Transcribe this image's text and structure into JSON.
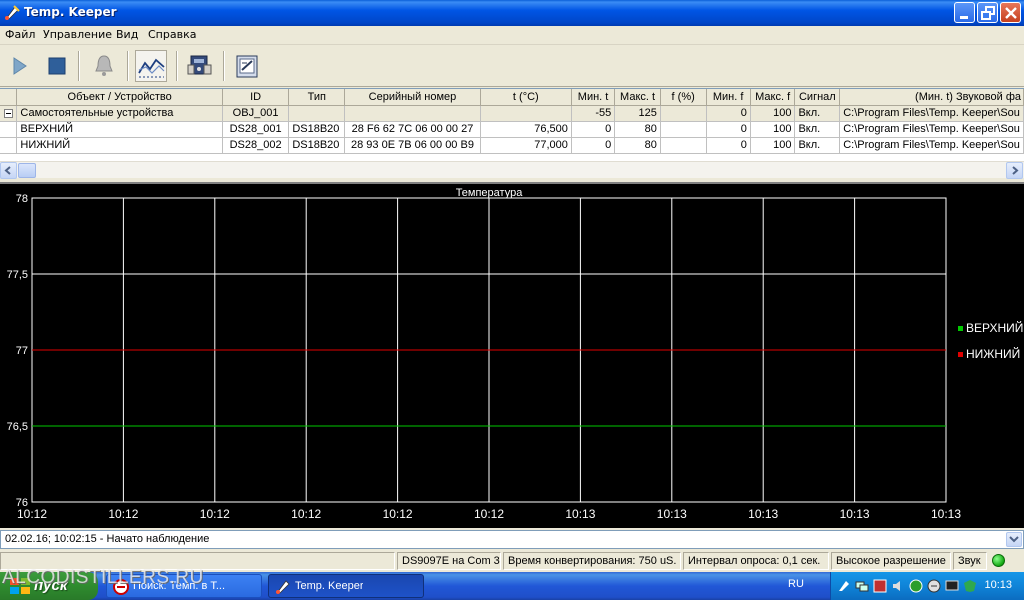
{
  "window": {
    "title": "Temp. Keeper"
  },
  "menu": [
    "Файл",
    "Управление",
    "Вид",
    "Справка"
  ],
  "toolbar": {
    "buttons": [
      {
        "name": "play-button",
        "icon": "play-icon"
      },
      {
        "name": "stop-button",
        "icon": "stop-icon"
      },
      {
        "name": "alarm-button",
        "icon": "bell-icon"
      },
      {
        "name": "chart-button",
        "icon": "chart-icon",
        "pressed": true
      },
      {
        "name": "device-button",
        "icon": "device-icon"
      },
      {
        "name": "report-button",
        "icon": "report-icon"
      }
    ]
  },
  "table": {
    "columns": [
      "Объект / Устройство",
      "ID",
      "Тип",
      "Серийный номер",
      "t (°C)",
      "Мин. t",
      "Макс. t",
      "f (%)",
      "Мин. f",
      "Макс. f",
      "Сигнал",
      "(Мин. t) Звуковой фа"
    ],
    "group": {
      "name": "Самостоятельные устройства",
      "id": "OBJ_001",
      "min_t": "-55",
      "max_t": "125",
      "min_f": "0",
      "max_f": "100",
      "signal": "Вкл.",
      "sound": "C:\\Program Files\\Temp. Keeper\\Sou"
    },
    "rows": [
      {
        "name": "ВЕРХНИЙ",
        "id": "DS28_001",
        "type": "DS18B20",
        "serial": "28 F6 62 7C 06 00 00 27",
        "t": "76,500",
        "min_t": "0",
        "max_t": "80",
        "f": "",
        "min_f": "0",
        "max_f": "100",
        "signal": "Вкл.",
        "sound": "C:\\Program Files\\Temp. Keeper\\Sou"
      },
      {
        "name": "НИЖНИЙ",
        "id": "DS28_002",
        "type": "DS18B20",
        "serial": "28 93 0E 7B 06 00 00 B9",
        "t": "77,000",
        "min_t": "0",
        "max_t": "80",
        "f": "",
        "min_f": "0",
        "max_f": "100",
        "signal": "Вкл.",
        "sound": "C:\\Program Files\\Temp. Keeper\\Sou"
      }
    ]
  },
  "chart_data": {
    "type": "line",
    "title": "Температура",
    "ylim": [
      76,
      78
    ],
    "y_ticks": [
      "78",
      "77,5",
      "77",
      "76,5",
      "76"
    ],
    "y_tick_values": [
      78,
      77.5,
      77,
      76.5,
      76
    ],
    "x_ticks": [
      "10:12",
      "10:12",
      "10:12",
      "10:12",
      "10:12",
      "10:12",
      "10:13",
      "10:13",
      "10:13",
      "10:13",
      "10:13"
    ],
    "grid": true,
    "legend_position": "right",
    "series": [
      {
        "name": "ВЕРХНИЙ",
        "color": "#00c800",
        "values": [
          76.5,
          76.5,
          76.5,
          76.5,
          76.5,
          76.5,
          76.5,
          76.5,
          76.5,
          76.5,
          76.5
        ]
      },
      {
        "name": "НИЖНИЙ",
        "color": "#e00000",
        "values": [
          77,
          77,
          77,
          77,
          77,
          77,
          77,
          77,
          77,
          77,
          77
        ]
      }
    ]
  },
  "log": {
    "text": "02.02.16; 10:02:15 - Начато наблюдение"
  },
  "status": {
    "port": "DS9097E на Com 3",
    "conversion": "Время конвертирования: 750 uS.",
    "interval": "Интервал опроса: 0,1 сек.",
    "resolution": "Высокое разрешение",
    "sound": "Звук",
    "led_color": "#12a812"
  },
  "taskbar": {
    "start_label": "пуск",
    "watermark": "ALCODISTILLERS.RU",
    "items": [
      {
        "label": "Поиск: Темп. в Т...",
        "active": false
      },
      {
        "label": "Temp. Keeper",
        "active": true
      }
    ],
    "lang": "RU",
    "clock": "10:13"
  },
  "colors": {
    "titlebar": "#0055e5",
    "chart_bg": "#000000",
    "grid_line": "#ffffff"
  }
}
